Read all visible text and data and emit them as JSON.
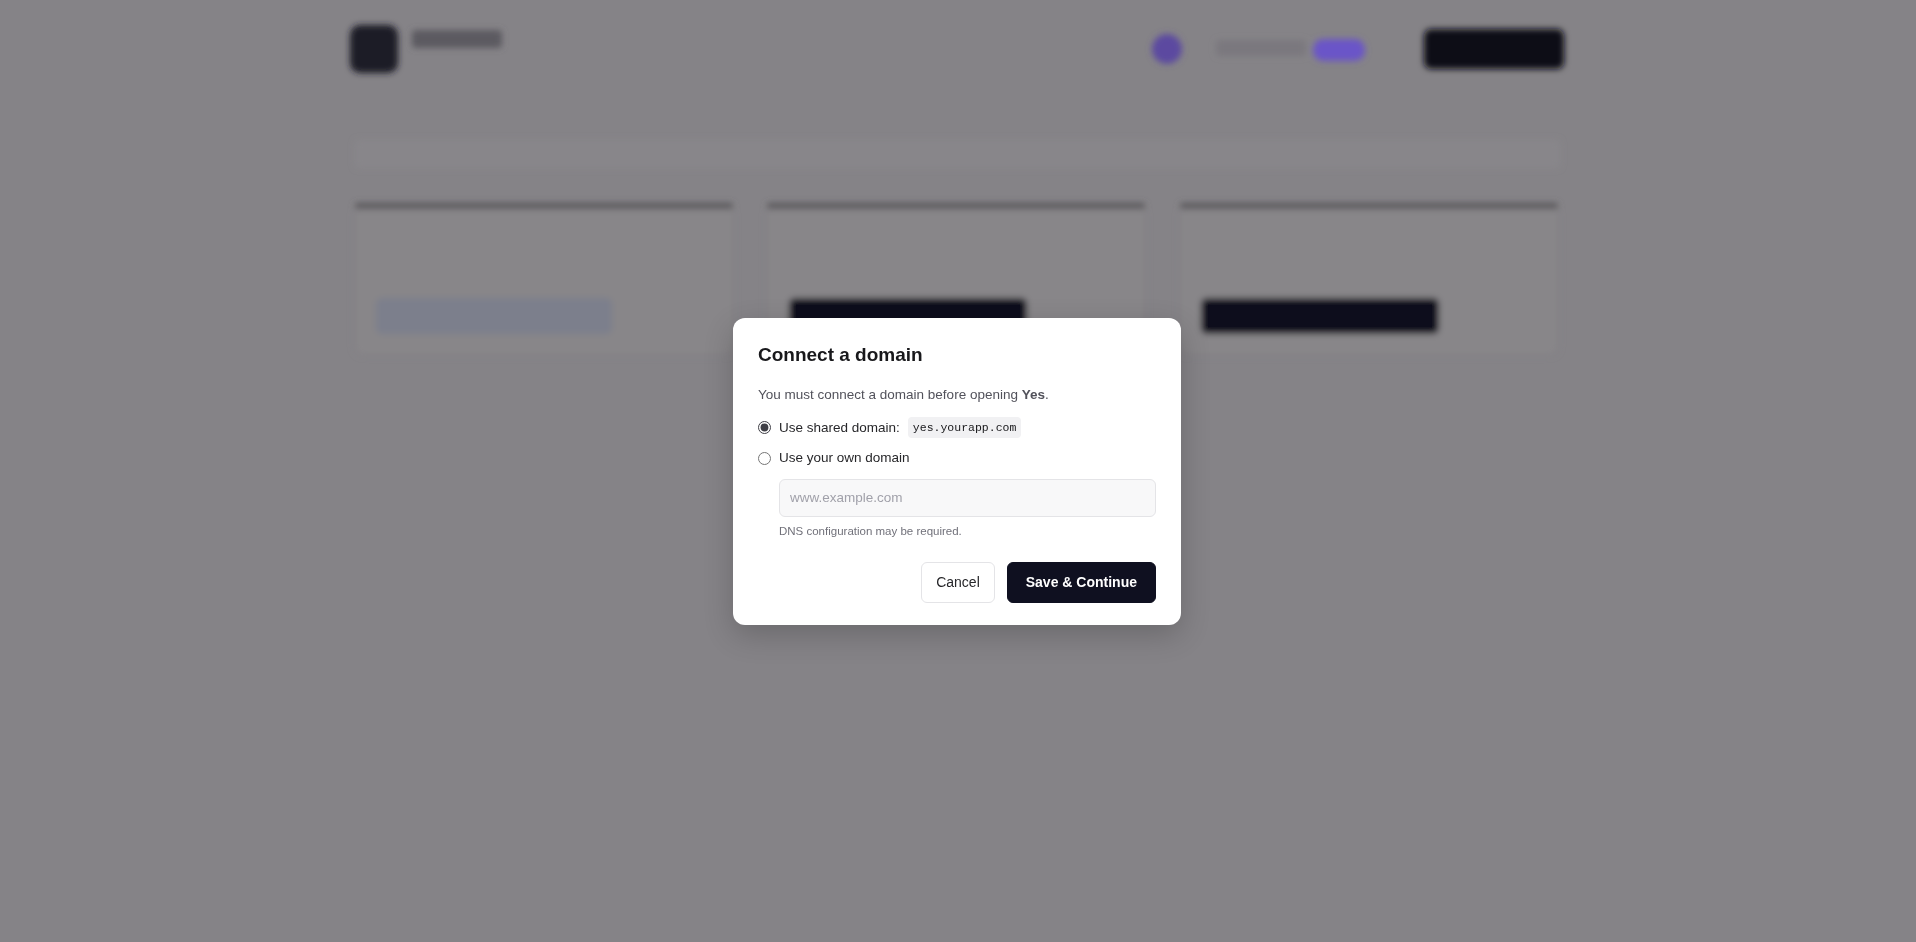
{
  "dialog": {
    "title": "Connect a domain",
    "message": "You must connect a domain before opening **Yes**.",
    "options": [
      {
        "kind": "shared",
        "label": "Use shared domain:",
        "domain": "yes.yourapp.com",
        "selected": true
      },
      {
        "kind": "custom",
        "label": "Use your own domain",
        "selected": false,
        "placeholder": "www.example.com",
        "hint": "DNS configuration may be required."
      }
    ],
    "buttons": [
      {
        "kind": "secondary",
        "label": "Cancel"
      },
      {
        "kind": "primary",
        "label": "Save & Continue"
      }
    ]
  }
}
